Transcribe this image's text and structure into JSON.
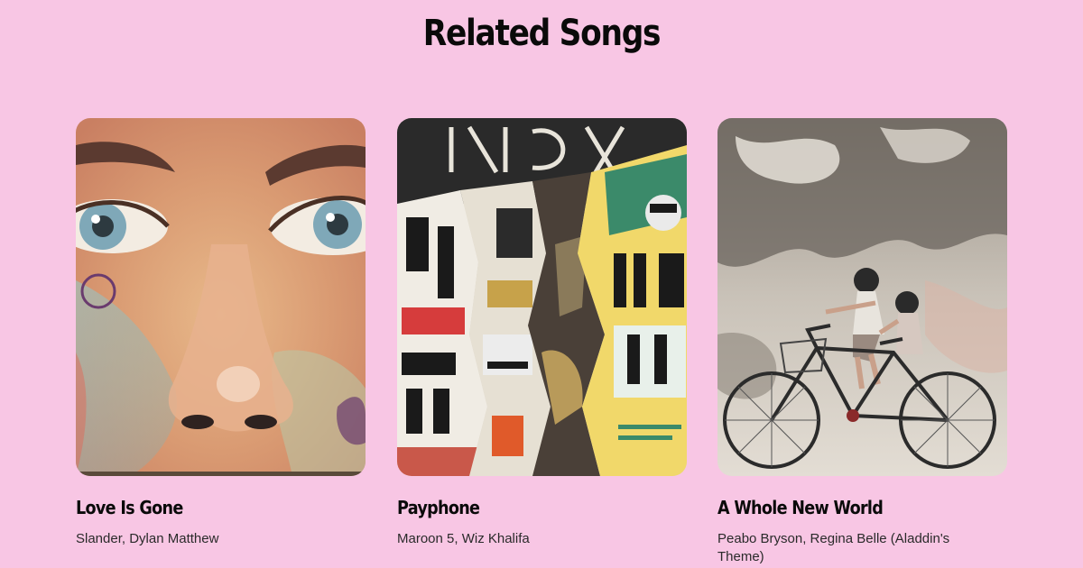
{
  "page": {
    "title": "Related Songs",
    "background_color": "#f8c6e4"
  },
  "songs": [
    {
      "title": "Love Is Gone",
      "artist": "Slander, Dylan Matthew",
      "artwork": "street-art-face-mural"
    },
    {
      "title": "Payphone",
      "artist": "Maroon 5, Wiz Khalifa",
      "artwork": "torn-posters-collage"
    },
    {
      "title": "A Whole New World",
      "artist": "Peabo Bryson, Regina Belle (Aladdin's Theme)",
      "artwork": "kids-on-bicycle-mural"
    }
  ]
}
